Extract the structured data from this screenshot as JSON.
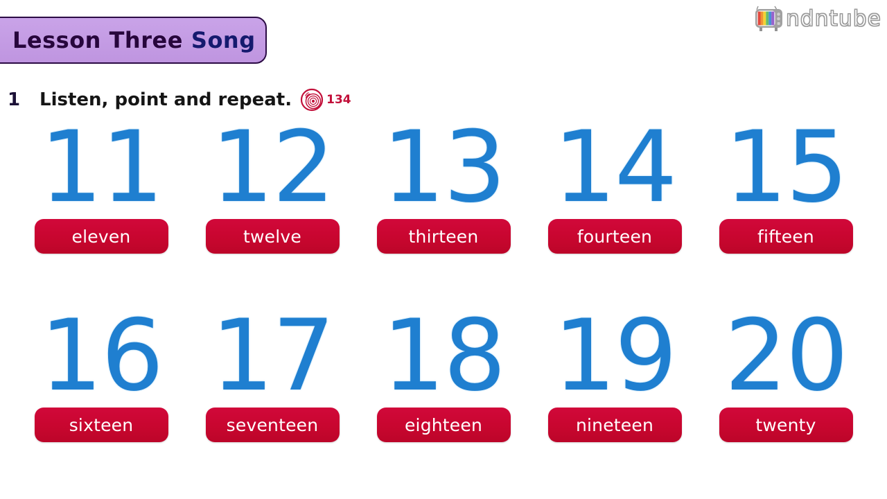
{
  "page": {
    "background_color": "#ffffff",
    "blue_number_color": "#1f7fd0",
    "pill_color": "#c8062f",
    "banner_color": "#c49ce4"
  },
  "watermark": {
    "brand": "ndntube",
    "tv_icon": "retro-tv-rainbow-icon",
    "stripe_colors": [
      "#e03b2e",
      "#f08a22",
      "#f2d023",
      "#5cb85c",
      "#3a86d4",
      "#8e55c8"
    ]
  },
  "banner": {
    "lesson_label": "Lesson Three",
    "song_label": "Song",
    "lesson_color": "#27063c",
    "song_color": "#151a6e"
  },
  "instruction": {
    "exercise_number": "1",
    "text": "Listen, point and repeat.",
    "audio_icon": "cd-record-icon",
    "track_number": "134",
    "track_color": "#c2103a"
  },
  "number_grid": {
    "rows": [
      [
        {
          "digit": "11",
          "word": "eleven"
        },
        {
          "digit": "12",
          "word": "twelve"
        },
        {
          "digit": "13",
          "word": "thirteen"
        },
        {
          "digit": "14",
          "word": "fourteen"
        },
        {
          "digit": "15",
          "word": "fifteen"
        }
      ],
      [
        {
          "digit": "16",
          "word": "sixteen"
        },
        {
          "digit": "17",
          "word": "seventeen"
        },
        {
          "digit": "18",
          "word": "eighteen"
        },
        {
          "digit": "19",
          "word": "nineteen"
        },
        {
          "digit": "20",
          "word": "twenty"
        }
      ]
    ]
  }
}
